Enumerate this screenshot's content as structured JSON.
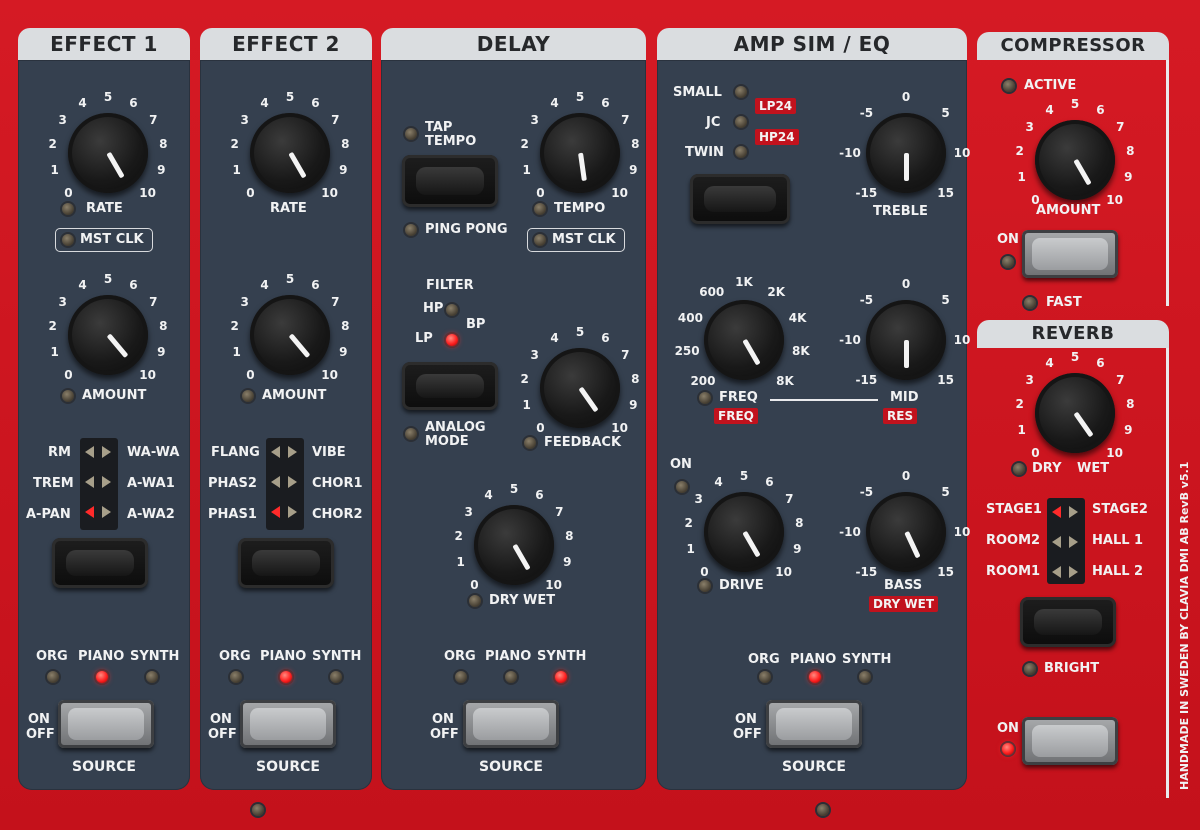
{
  "sections": {
    "effect1": {
      "title": "EFFECT 1",
      "rate": "RATE",
      "mst_clk": "MST CLK",
      "amount": "AMOUNT",
      "modes_left": [
        "RM",
        "TREM",
        "A-PAN"
      ],
      "modes_right": [
        "WA-WA",
        "A-WA1",
        "A-WA2"
      ],
      "sources": [
        "ORG",
        "PIANO",
        "SYNTH"
      ],
      "on": "ON",
      "off": "OFF",
      "source": "SOURCE"
    },
    "effect2": {
      "title": "EFFECT 2",
      "rate": "RATE",
      "amount": "AMOUNT",
      "modes_left": [
        "FLANG",
        "PHAS2",
        "PHAS1"
      ],
      "modes_right": [
        "VIBE",
        "CHOR1",
        "CHOR2"
      ],
      "sources": [
        "ORG",
        "PIANO",
        "SYNTH"
      ],
      "on": "ON",
      "off": "OFF",
      "source": "SOURCE"
    },
    "delay": {
      "title": "DELAY",
      "tap_tempo": "TAP\nTEMPO",
      "ping_pong": "PING PONG",
      "tempo": "TEMPO",
      "mst_clk": "MST CLK",
      "filter": "FILTER",
      "hp": "HP",
      "bp": "BP",
      "lp": "LP",
      "analog_mode": "ANALOG\nMODE",
      "feedback": "FEEDBACK",
      "dry_wet": "DRY WET",
      "sources": [
        "ORG",
        "PIANO",
        "SYNTH"
      ],
      "on": "ON",
      "off": "OFF",
      "source": "SOURCE"
    },
    "amp": {
      "title": "AMP SIM / EQ",
      "small": "SMALL",
      "jc": "JC",
      "twin": "TWIN",
      "lp24": "LP24",
      "hp24": "HP24",
      "treble": "TREBLE",
      "freq": "FREQ",
      "freq_tag": "FREQ",
      "mid": "MID",
      "res_tag": "RES",
      "on": "ON",
      "drive": "DRIVE",
      "bass": "BASS",
      "drywet_tag": "DRY WET",
      "freq_ticks": [
        "200",
        "250",
        "400",
        "600",
        "1K",
        "2K",
        "4K",
        "8K",
        "8K"
      ],
      "sources": [
        "ORG",
        "PIANO",
        "SYNTH"
      ],
      "on2": "ON",
      "off": "OFF",
      "source": "SOURCE"
    },
    "compressor": {
      "title": "COMPRESSOR",
      "active": "ACTIVE",
      "amount": "AMOUNT",
      "on": "ON",
      "fast": "FAST"
    },
    "reverb": {
      "title": "REVERB",
      "dry": "DRY",
      "wet": "WET",
      "modes_left": [
        "STAGE1",
        "ROOM2",
        "ROOM1"
      ],
      "modes_right": [
        "STAGE2",
        "HALL 1",
        "HALL 2"
      ],
      "bright": "BRIGHT",
      "on": "ON"
    }
  },
  "ticks_0_10": [
    "0",
    "1",
    "2",
    "3",
    "4",
    "5",
    "6",
    "7",
    "8",
    "9",
    "10"
  ],
  "ticks_eq": [
    "-15",
    "-10",
    "-5",
    "0",
    "5",
    "10",
    "15"
  ],
  "side_text": "HANDMADE IN SWEDEN BY CLAVIA DMI AB   RevB v5.1",
  "colors": {
    "body_red": "#c8141e",
    "panel": "#35404f",
    "header": "#dadde0",
    "led_on": "#ff2020"
  }
}
